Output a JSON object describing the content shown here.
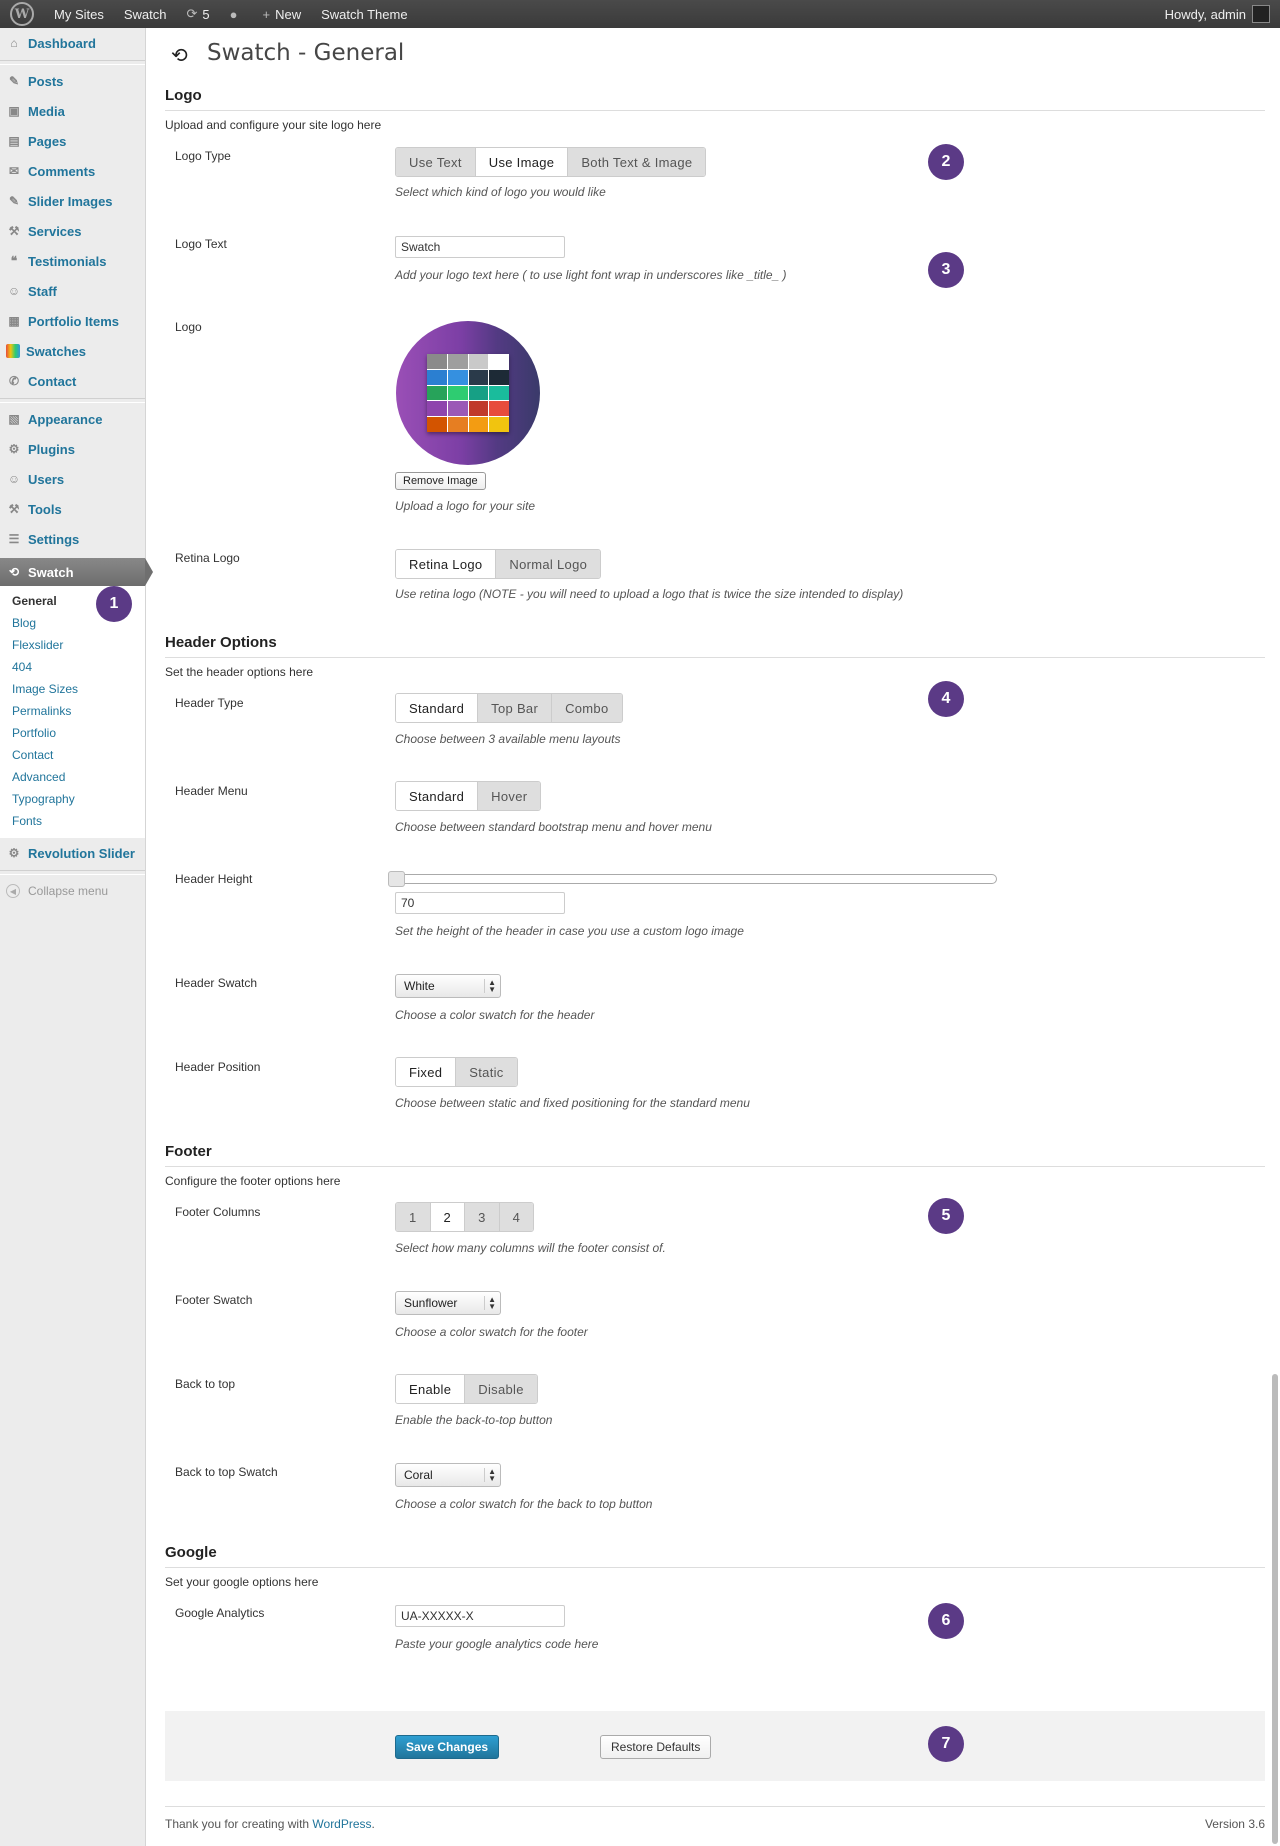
{
  "adminbar": {
    "logo": "W",
    "my_sites": "My Sites",
    "site": "Swatch",
    "updates_count": "5",
    "new_label": "New",
    "theme": "Swatch Theme",
    "howdy": "Howdy, admin"
  },
  "sidebar": {
    "items": [
      {
        "label": "Dashboard",
        "icon": "dashboard-icon"
      },
      {
        "label": "Posts",
        "icon": "pin-icon"
      },
      {
        "label": "Media",
        "icon": "media-icon"
      },
      {
        "label": "Pages",
        "icon": "pages-icon"
      },
      {
        "label": "Comments",
        "icon": "comments-icon"
      },
      {
        "label": "Slider Images",
        "icon": "pin-icon"
      },
      {
        "label": "Services",
        "icon": "wrench-icon"
      },
      {
        "label": "Testimonials",
        "icon": "quote-icon"
      },
      {
        "label": "Staff",
        "icon": "users-icon"
      },
      {
        "label": "Portfolio Items",
        "icon": "briefcase-icon"
      },
      {
        "label": "Swatches",
        "icon": "swatch-icon"
      },
      {
        "label": "Contact",
        "icon": "contact-icon"
      },
      {
        "label": "Appearance",
        "icon": "appearance-icon"
      },
      {
        "label": "Plugins",
        "icon": "plugin-icon"
      },
      {
        "label": "Users",
        "icon": "users-icon"
      },
      {
        "label": "Tools",
        "icon": "tools-icon"
      },
      {
        "label": "Settings",
        "icon": "settings-icon"
      }
    ],
    "active": "Swatch",
    "submenu": [
      "General",
      "Blog",
      "Flexslider",
      "404",
      "Image Sizes",
      "Permalinks",
      "Portfolio",
      "Contact",
      "Advanced",
      "Typography",
      "Fonts"
    ],
    "revolution": "Revolution Slider",
    "collapse": "Collapse menu"
  },
  "badges": [
    "1",
    "2",
    "3",
    "4",
    "5",
    "6",
    "7"
  ],
  "page": {
    "title": "Swatch - General"
  },
  "logo_section": {
    "heading": "Logo",
    "desc": "Upload and configure your site logo here",
    "logo_type": {
      "label": "Logo Type",
      "options": [
        "Use Text",
        "Use Image",
        "Both Text & Image"
      ],
      "selected": "Use Image",
      "help": "Select which kind of logo you would like"
    },
    "logo_text": {
      "label": "Logo Text",
      "value": "Swatch",
      "help": "Add your logo text here ( to use light font wrap in underscores like _title_ )"
    },
    "logo": {
      "label": "Logo",
      "remove": "Remove Image",
      "help": "Upload a logo for your site",
      "grid_colors": [
        "#8a8a8a",
        "#9e9e9e",
        "#c9c9c9",
        "#ffffff",
        "#2b7fd1",
        "#3590e0",
        "#2a3a4a",
        "#1d2a36",
        "#27a35a",
        "#2ecc71",
        "#16a085",
        "#1abc9c",
        "#8e44ad",
        "#9b59b6",
        "#c0392b",
        "#e74c3c",
        "#d35400",
        "#e67e22",
        "#f39c12",
        "#f1c40f"
      ]
    },
    "retina": {
      "label": "Retina Logo",
      "options": [
        "Retina Logo",
        "Normal Logo"
      ],
      "selected": "Retina Logo",
      "help": "Use retina logo (NOTE - you will need to upload a logo that is twice the size intended to display)"
    }
  },
  "header_section": {
    "heading": "Header Options",
    "desc": "Set the header options here",
    "header_type": {
      "label": "Header Type",
      "options": [
        "Standard",
        "Top Bar",
        "Combo"
      ],
      "selected": "Standard",
      "help": "Choose between 3 available menu layouts"
    },
    "header_menu": {
      "label": "Header Menu",
      "options": [
        "Standard",
        "Hover"
      ],
      "selected": "Standard",
      "help": "Choose between standard bootstrap menu and hover menu"
    },
    "header_height": {
      "label": "Header Height",
      "value": "70",
      "help": "Set the height of the header in case you use a custom logo image"
    },
    "header_swatch": {
      "label": "Header Swatch",
      "value": "White",
      "help": "Choose a color swatch for the header"
    },
    "header_position": {
      "label": "Header Position",
      "options": [
        "Fixed",
        "Static"
      ],
      "selected": "Fixed",
      "help": "Choose between static and fixed positioning for the standard menu"
    }
  },
  "footer_section": {
    "heading": "Footer",
    "desc": "Configure the footer options here",
    "columns": {
      "label": "Footer Columns",
      "options": [
        "1",
        "2",
        "3",
        "4"
      ],
      "selected": "2",
      "help": "Select how many columns will the footer consist of."
    },
    "swatch": {
      "label": "Footer Swatch",
      "value": "Sunflower",
      "help": "Choose a color swatch for the footer"
    },
    "back_to_top": {
      "label": "Back to top",
      "options": [
        "Enable",
        "Disable"
      ],
      "selected": "Enable",
      "help": "Enable the back-to-top button"
    },
    "back_to_top_swatch": {
      "label": "Back to top Swatch",
      "value": "Coral",
      "help": "Choose a color swatch for the back to top button"
    }
  },
  "google_section": {
    "heading": "Google",
    "desc": "Set your google options here",
    "analytics": {
      "label": "Google Analytics",
      "value": "UA-XXXXX-X",
      "help": "Paste your google analytics code here"
    }
  },
  "actions": {
    "save": "Save Changes",
    "restore": "Restore Defaults"
  },
  "footer": {
    "thanks": "Thank you for creating with ",
    "wordpress": "WordPress",
    "period": ".",
    "version": "Version 3.6"
  },
  "colors": {
    "link": "#21759b",
    "badge": "#5b3a86",
    "primary_button": "#21759b"
  }
}
